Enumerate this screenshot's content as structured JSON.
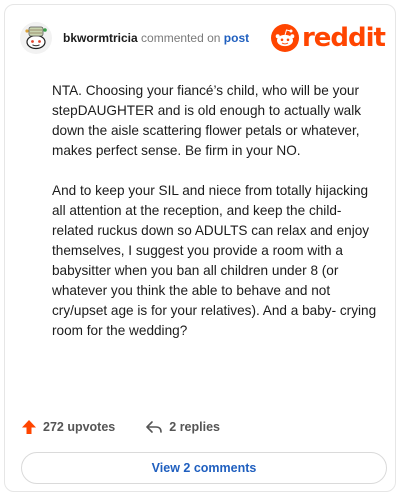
{
  "header": {
    "username": "bkwormtricia",
    "verb": "commented on",
    "post_link": "post",
    "logo_text": "reddit"
  },
  "comment": {
    "paragraphs": [
      "NTA. Choosing your fiancé’s child, who will be your stepDAUGHTER and is old enough to actually walk down the aisle scattering flower petals or whatever, makes perfect sense. Be firm in your NO.",
      "And to keep your SIL and niece from totally hijacking all attention at the reception, and keep the child-related ruckus down so ADULTS can relax and enjoy themselves, I suggest you provide a room with a babysitter when you ban all children under 8 (or whatever you think the able to behave and not cry/upset age is for your relatives). And a baby- crying room for the wedding?"
    ]
  },
  "actions": {
    "upvotes": "272 upvotes",
    "replies": "2 replies"
  },
  "footer": {
    "view_comments": "View 2 comments"
  },
  "colors": {
    "brand": "#ff4500",
    "link": "#1f5fbf",
    "text": "#1c1c1c",
    "muted": "#7a7a7a"
  },
  "icons": [
    "snoo-avatar-icon",
    "reddit-logo-icon",
    "upvote-arrow-icon",
    "reply-arrow-icon"
  ]
}
